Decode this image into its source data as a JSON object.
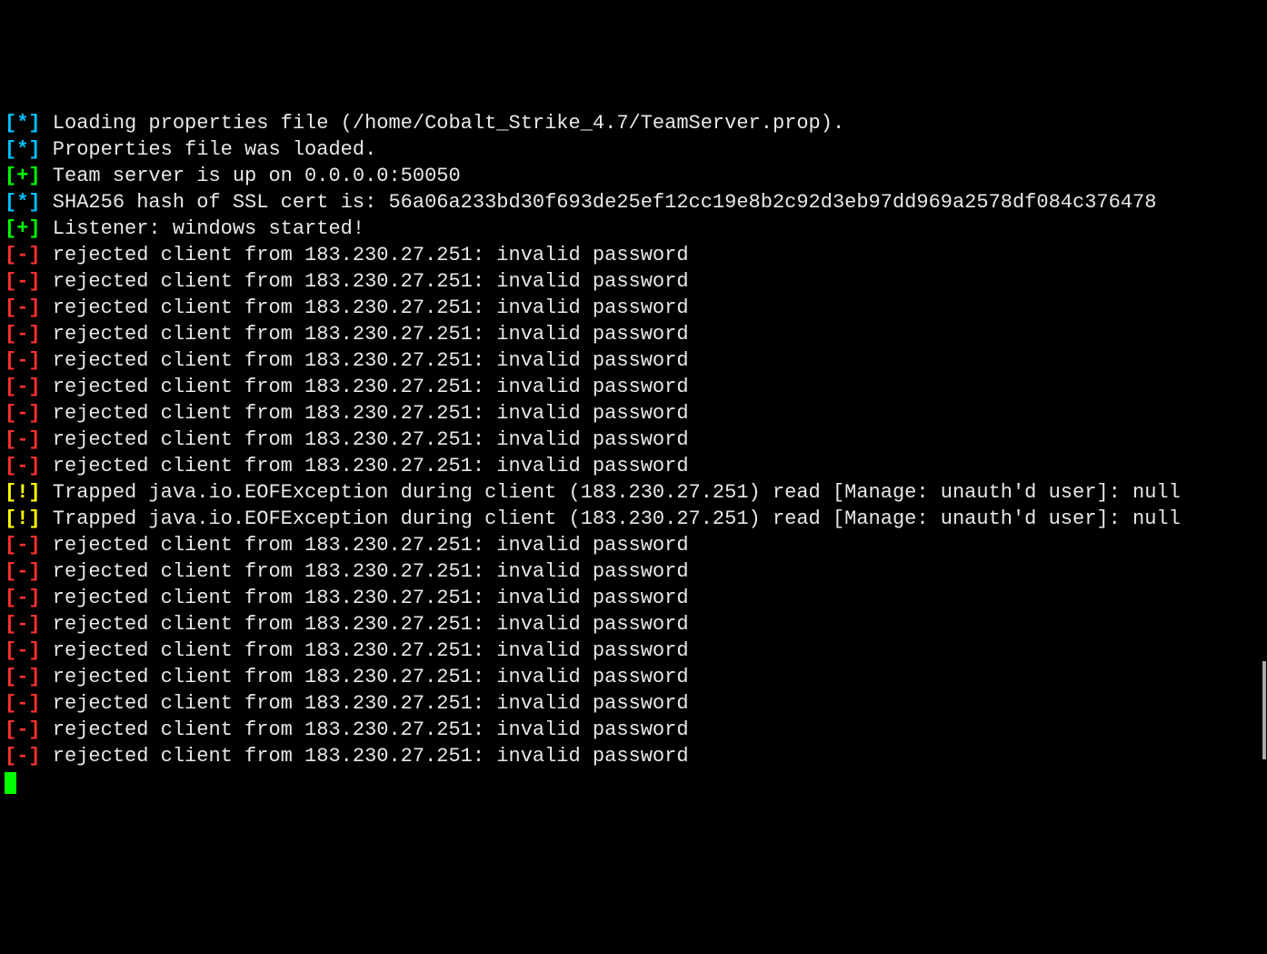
{
  "prefixes": {
    "star": "[*]",
    "plus": "[+]",
    "minus": "[-]",
    "bang": "[!]"
  },
  "lines": [
    {
      "prefix": "star",
      "msg": " Loading properties file (/home/Cobalt_Strike_4.7/TeamServer.prop)."
    },
    {
      "prefix": "star",
      "msg": " Properties file was loaded."
    },
    {
      "prefix": "plus",
      "msg": " Team server is up on 0.0.0.0:50050"
    },
    {
      "prefix": "star",
      "msg": " SHA256 hash of SSL cert is: 56a06a233bd30f693de25ef12cc19e8b2c92d3eb97dd969a2578df084c376478"
    },
    {
      "prefix": "plus",
      "msg": " Listener: windows started!"
    },
    {
      "prefix": "minus",
      "msg": " rejected client from 183.230.27.251: invalid password"
    },
    {
      "prefix": "minus",
      "msg": " rejected client from 183.230.27.251: invalid password"
    },
    {
      "prefix": "minus",
      "msg": " rejected client from 183.230.27.251: invalid password"
    },
    {
      "prefix": "minus",
      "msg": " rejected client from 183.230.27.251: invalid password"
    },
    {
      "prefix": "minus",
      "msg": " rejected client from 183.230.27.251: invalid password"
    },
    {
      "prefix": "minus",
      "msg": " rejected client from 183.230.27.251: invalid password"
    },
    {
      "prefix": "minus",
      "msg": " rejected client from 183.230.27.251: invalid password"
    },
    {
      "prefix": "minus",
      "msg": " rejected client from 183.230.27.251: invalid password"
    },
    {
      "prefix": "minus",
      "msg": " rejected client from 183.230.27.251: invalid password"
    },
    {
      "prefix": "bang",
      "msg": " Trapped java.io.EOFException during client (183.230.27.251) read [Manage: unauth'd user]: null"
    },
    {
      "prefix": "bang",
      "msg": " Trapped java.io.EOFException during client (183.230.27.251) read [Manage: unauth'd user]: null"
    },
    {
      "prefix": "minus",
      "msg": " rejected client from 183.230.27.251: invalid password"
    },
    {
      "prefix": "minus",
      "msg": " rejected client from 183.230.27.251: invalid password"
    },
    {
      "prefix": "minus",
      "msg": " rejected client from 183.230.27.251: invalid password"
    },
    {
      "prefix": "minus",
      "msg": " rejected client from 183.230.27.251: invalid password"
    },
    {
      "prefix": "minus",
      "msg": " rejected client from 183.230.27.251: invalid password"
    },
    {
      "prefix": "minus",
      "msg": " rejected client from 183.230.27.251: invalid password"
    },
    {
      "prefix": "minus",
      "msg": " rejected client from 183.230.27.251: invalid password"
    },
    {
      "prefix": "minus",
      "msg": " rejected client from 183.230.27.251: invalid password"
    },
    {
      "prefix": "minus",
      "msg": " rejected client from 183.230.27.251: invalid password"
    }
  ]
}
